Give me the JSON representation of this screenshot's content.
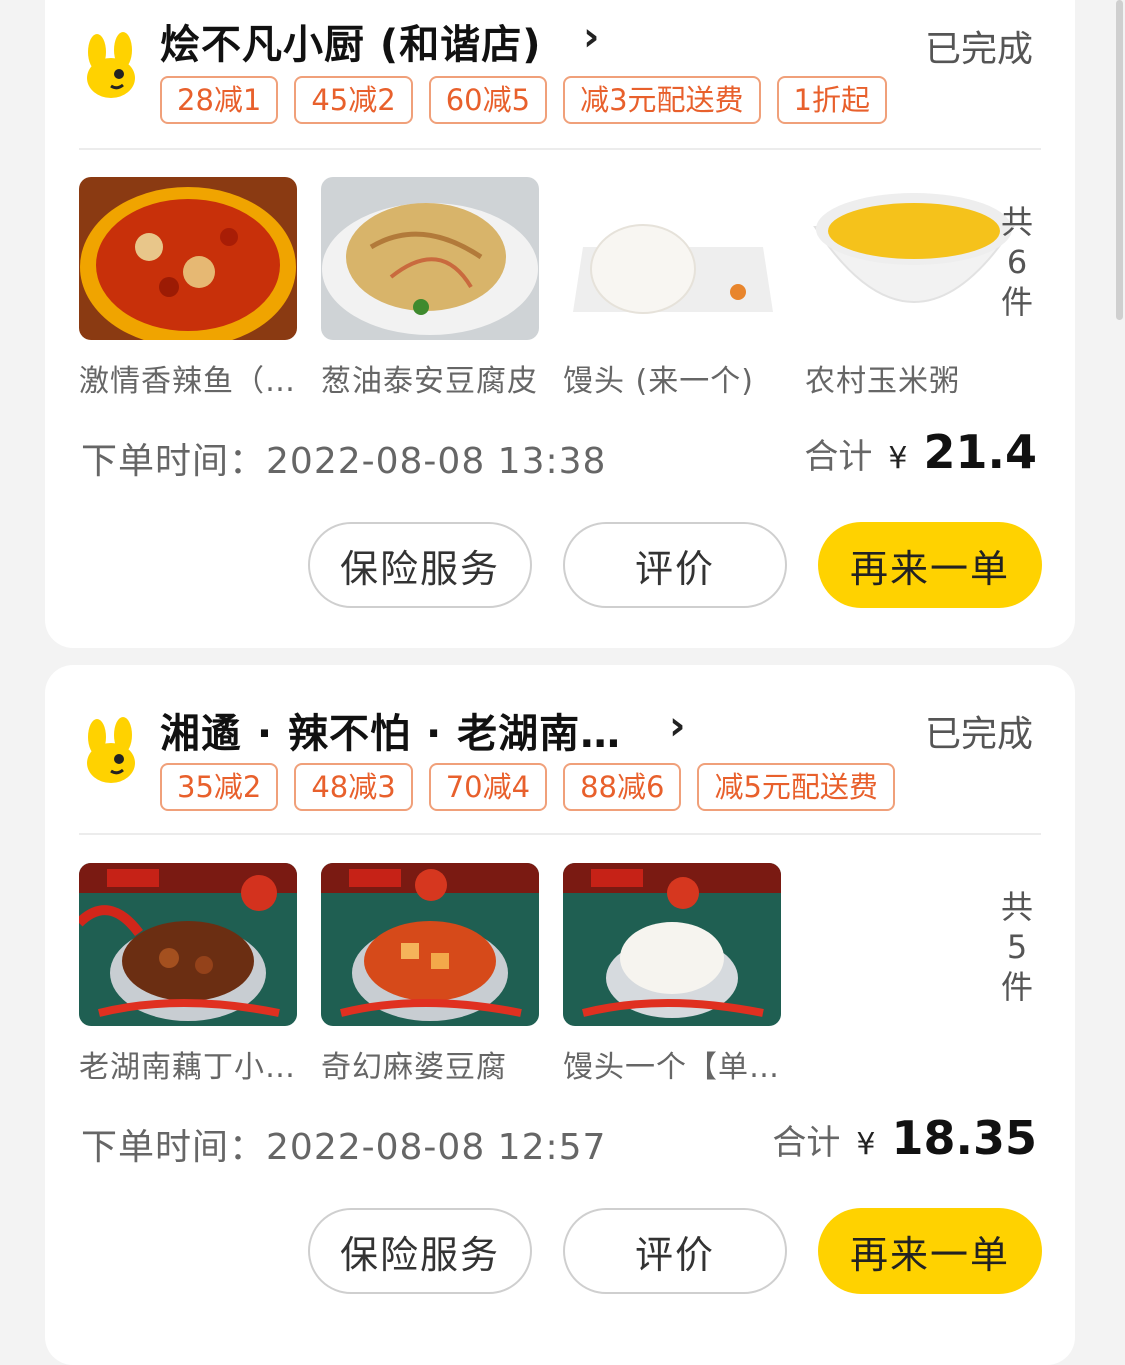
{
  "orders": [
    {
      "shop_name": "烩不凡小厨 (和谐店)",
      "status": "已完成",
      "tags": [
        "28减1",
        "45减2",
        "60减5",
        "减3元配送费",
        "1折起"
      ],
      "items": [
        "激情香辣鱼（…",
        "葱油泰安豆腐皮",
        "馒头 (来一个)",
        "农村玉米粥"
      ],
      "item_count_label": [
        "共",
        "6",
        "件"
      ],
      "order_time_label": "下单时间：",
      "order_time": "2022-08-08 13:38",
      "total_label": "合计",
      "currency": "¥",
      "total": "21.4",
      "buttons": {
        "insurance": "保险服务",
        "review": "评价",
        "reorder": "再来一单"
      }
    },
    {
      "shop_name": "湘遹 · 辣不怕 · 老湖南…",
      "status": "已完成",
      "tags": [
        "35减2",
        "48减3",
        "70减4",
        "88减6",
        "减5元配送费"
      ],
      "items": [
        "老湖南藕丁小…",
        "奇幻麻婆豆腐",
        "馒头一个【单…"
      ],
      "item_count_label": [
        "共",
        "5",
        "件"
      ],
      "order_time_label": "下单时间：",
      "order_time": "2022-08-08 12:57",
      "total_label": "合计",
      "currency": "¥",
      "total": "18.35",
      "buttons": {
        "insurance": "保险服务",
        "review": "评价",
        "reorder": "再来一单"
      }
    }
  ],
  "colors": {
    "accent": "#ffd200",
    "tag_text": "#e8602c",
    "tag_border": "#f0a07a"
  },
  "icons": {
    "shop_logo": "meituan-kangaroo-icon",
    "chevron": "chevron-right-icon"
  }
}
